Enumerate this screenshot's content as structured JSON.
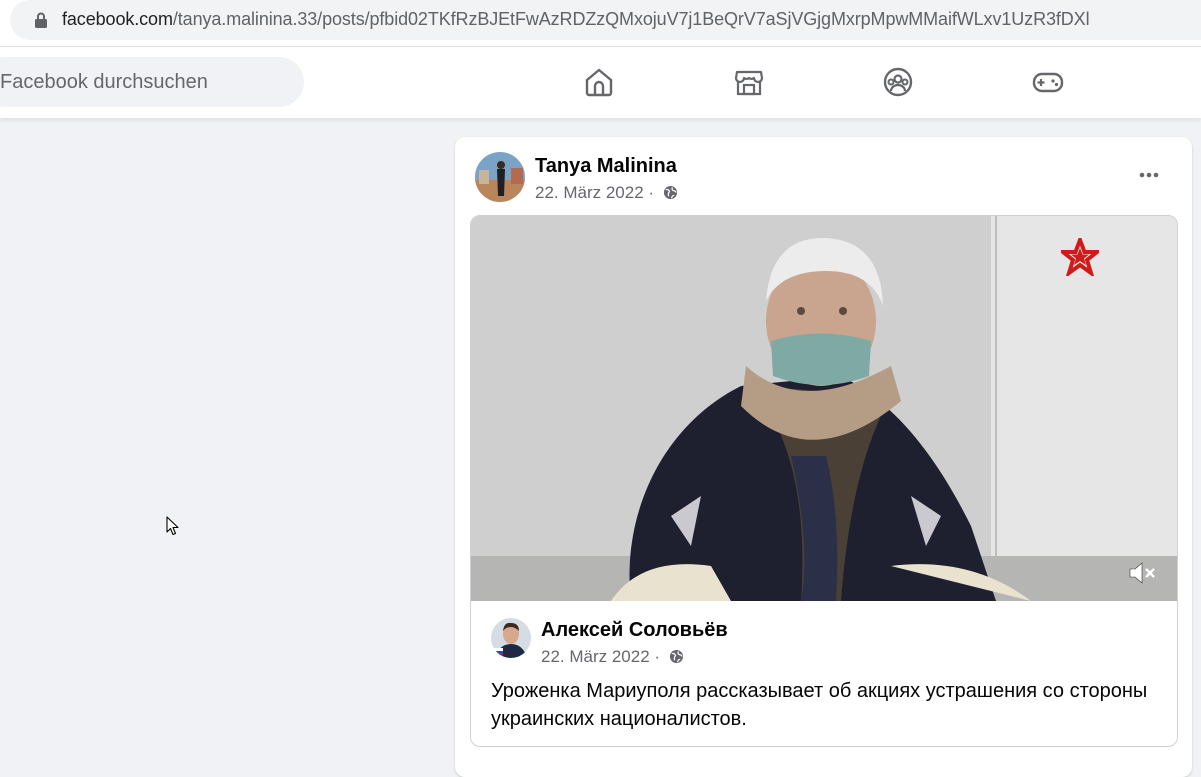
{
  "browser": {
    "url_host": "facebook.com",
    "url_path": "/tanya.malinina.33/posts/pfbid02TKfRzBJEtFwAzRDZzQMxojuV7j1BeQrV7aSjVGjgMxrpMpwMMaifWLxv1UzR3fDXl",
    "icon": "lock-icon"
  },
  "header": {
    "search_placeholder": "Facebook durchsuchen",
    "nav_icons": [
      "home-icon",
      "marketplace-icon",
      "groups-icon",
      "gaming-icon"
    ]
  },
  "post": {
    "author": "Tanya Malinina",
    "date": "22. März 2022",
    "separator": "·",
    "privacy_icon": "globe-icon",
    "more_icon": "more-icon",
    "shared": {
      "video_overlay_icon": "star-icon",
      "mute_icon": "mute-icon",
      "author": "Алексей Соловьёв",
      "date": "22. März 2022",
      "separator": "·",
      "text": "Уроженка Мариуполя рассказывает об акциях устрашения со стороны украинских националистов."
    }
  },
  "colors": {
    "fb_background": "#f0f2f5",
    "secondary_text": "#65676b",
    "primary_text": "#050505"
  }
}
